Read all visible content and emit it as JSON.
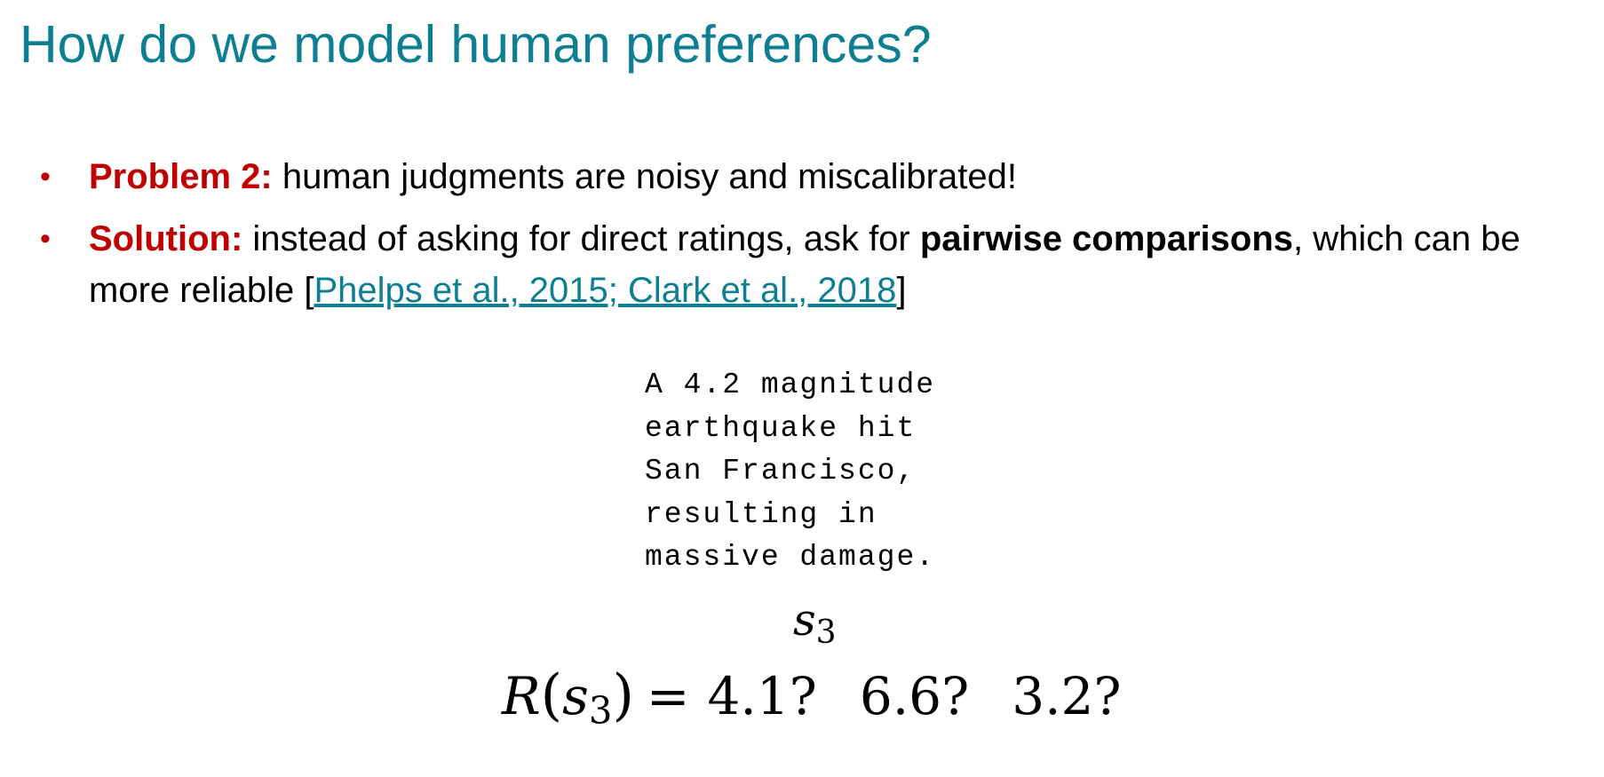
{
  "slide": {
    "title": "How do we model human preferences?"
  },
  "bullets": [
    {
      "keyword": "Problem 2:",
      "text": " human judgments are noisy and miscalibrated!"
    },
    {
      "keyword": "Solution:",
      "text_before": " instead of asking for direct ratings, ask for ",
      "emphasis": "pairwise comparisons",
      "text_after": ", which can be more reliable [",
      "citation": "Phelps et al., 2015; Clark et al., 2018",
      "text_end": "]"
    }
  ],
  "example": {
    "lines": [
      "A 4.2 magnitude",
      "earthquake hit",
      "San Francisco,",
      "resulting in",
      "massive damage."
    ],
    "label_var": "s",
    "label_sub": "3"
  },
  "formula": {
    "func": "R",
    "open_paren": "(",
    "var": "s",
    "sub": "3",
    "close_paren": ")",
    "equals": "=",
    "ratings": [
      "4.1?",
      "6.6?",
      "3.2?"
    ]
  },
  "colors": {
    "title": "#0e7f93",
    "keyword": "#c00000",
    "link": "#0e7f93"
  }
}
